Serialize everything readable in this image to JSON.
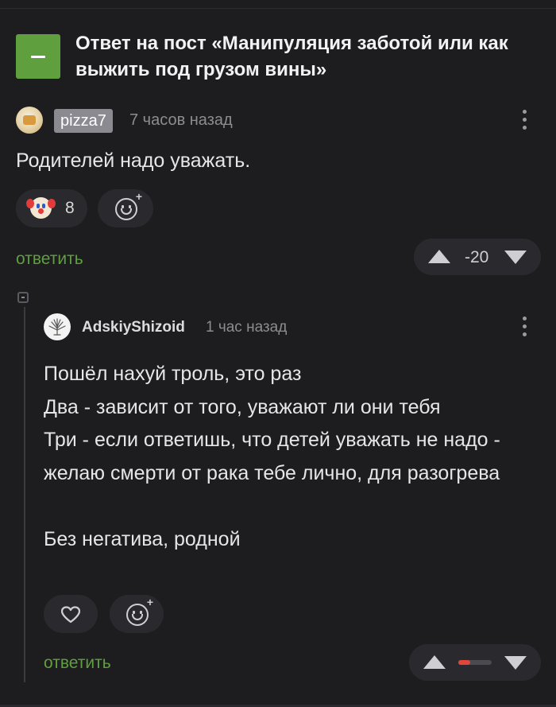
{
  "post": {
    "title": "Ответ на пост «Манипуляция заботой или как выжить под грузом вины»"
  },
  "comments": [
    {
      "username": "pizza7",
      "time": "7 часов назад",
      "text": "Родителей надо уважать.",
      "reaction": {
        "icon": "clown-face-icon",
        "count": "8"
      },
      "reply_label": "ответить",
      "score": "-20"
    },
    {
      "username": "AdskiyShizoid",
      "time": "1 час назад",
      "text": "Пошёл нахуй троль, это раз\nДва - зависит от того, уважают ли они тебя\nТри - если ответишь, что детей уважать не надо - желаю смерти от рака тебе лично, для разогрева\n\nБез негатива, родной",
      "reply_label": "ответить",
      "rating_fraction": 0.35
    }
  ],
  "colors": {
    "background": "#1d1d20",
    "accent_green": "#5f9f3e",
    "pill_bg": "#2a2a2e",
    "negative_red": "#e0473c"
  }
}
